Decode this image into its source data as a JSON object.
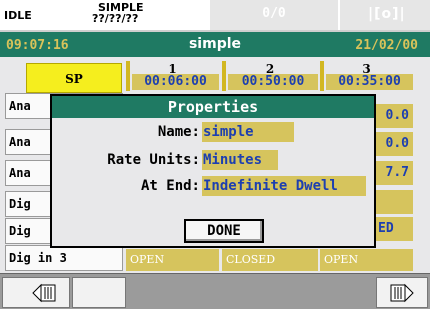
{
  "status": {
    "state": "IDLE",
    "program_name": "SIMPLE",
    "program_sub": "??/??/??",
    "counter": "0/0",
    "logo": "|[o]|"
  },
  "title": {
    "time": "09:07:16",
    "name": "simple",
    "date": "21/02/00"
  },
  "table": {
    "sp_label": "SP",
    "segments": [
      {
        "num": "1",
        "value": "00:06:00"
      },
      {
        "num": "2",
        "value": "00:50:00"
      },
      {
        "num": "3",
        "value": "00:35:00"
      }
    ],
    "rows": [
      {
        "label": "Ana",
        "right_value": "0.0"
      },
      {
        "label": "Ana",
        "right_value": "0.0"
      },
      {
        "label": "Ana",
        "right_value": "7.7"
      },
      {
        "label": "Dig",
        "right_value": ""
      },
      {
        "label": "Dig",
        "right_value": "ED"
      },
      {
        "label": "Dig in 3",
        "right_value": ""
      }
    ],
    "dig3_values": [
      "OPEN",
      "CLOSED",
      "OPEN"
    ]
  },
  "dialog": {
    "title": "Properties",
    "name_label": "Name:",
    "name_value": "simple",
    "rate_label": "Rate Units:",
    "rate_value": "Minutes",
    "end_label": "At End:",
    "end_value": "Indefinite Dwell",
    "done_label": "DONE"
  },
  "nav": {
    "left_icon": "scroll-left-icon",
    "right_icon": "scroll-right-icon"
  },
  "colors": {
    "title_bg": "#1f7a63",
    "field_bg": "#d6c45d",
    "field_text": "#1d3fb0",
    "sp_bg": "#f5ee1e",
    "time_text": "#d9c35a"
  }
}
